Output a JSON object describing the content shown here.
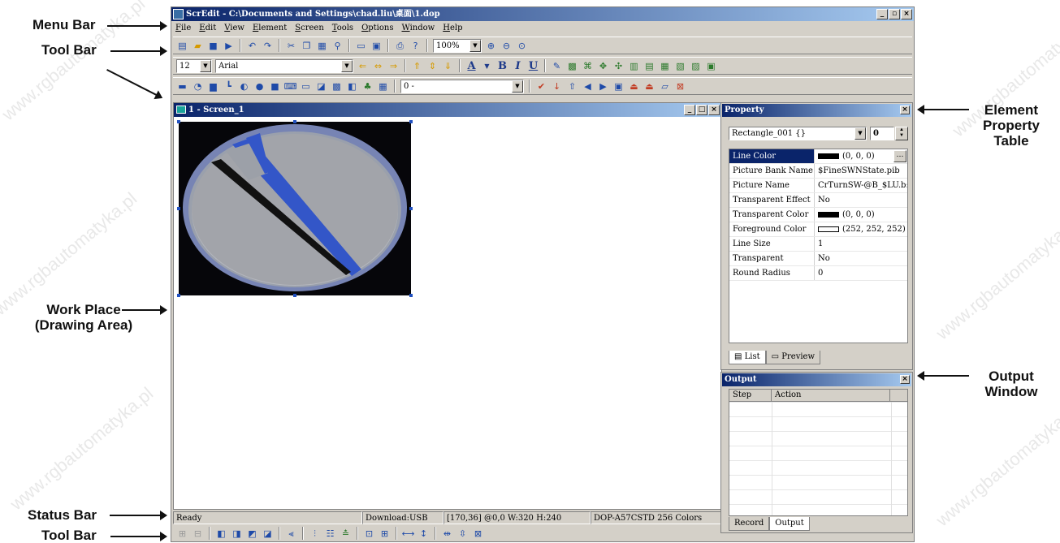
{
  "callouts": {
    "menu_bar": "Menu Bar",
    "tool_bar_top": "Tool Bar",
    "work_place_line1": "Work Place",
    "work_place_line2": "(Drawing Area)",
    "status_bar": "Status Bar",
    "tool_bar_bottom": "Tool Bar",
    "element_property_line1": "Element",
    "element_property_line2": "Property",
    "element_property_line3": "Table",
    "output_line1": "Output",
    "output_line2": "Window"
  },
  "window": {
    "title": "ScrEdit - C:\\Documents and Settings\\chad.liu\\桌面\\1.dop",
    "min_label": "_",
    "max_label": "▫",
    "close_label": "×"
  },
  "menu": [
    "File",
    "Edit",
    "View",
    "Element",
    "Screen",
    "Tools",
    "Options",
    "Window",
    "Help"
  ],
  "toolbar1": {
    "zoom_value": "100%"
  },
  "toolbar2": {
    "font_size": "12",
    "font_name": "Arial",
    "bold_label": "B",
    "italic_label": "I",
    "underline_label": "U",
    "font_color_label": "A"
  },
  "toolbar3": {
    "state_value": "0 -"
  },
  "mdi": {
    "title": "1 - Screen_1",
    "min_label": "_",
    "max_label": "□",
    "close_label": "×"
  },
  "property": {
    "title": "Property",
    "close_label": "×",
    "element_select": "Rectangle_001 {}",
    "state_value": "0",
    "rows": [
      {
        "name": "Line Color",
        "value": "(0, 0, 0)",
        "swatch": "#000000"
      },
      {
        "name": "Picture Bank Name",
        "value": "$FineSWNState.pib",
        "swatch": ""
      },
      {
        "name": "Picture Name",
        "value": "CrTurnSW-@B_$LU.b:",
        "swatch": ""
      },
      {
        "name": "Transparent Effect",
        "value": "No",
        "swatch": ""
      },
      {
        "name": "Transparent Color",
        "value": "(0, 0, 0)",
        "swatch": "#000000"
      },
      {
        "name": "Foreground Color",
        "value": "(252, 252, 252)",
        "swatch": "#fcfcfc"
      },
      {
        "name": "Line Size",
        "value": "1",
        "swatch": ""
      },
      {
        "name": "Transparent",
        "value": "No",
        "swatch": ""
      },
      {
        "name": "Round Radius",
        "value": "0",
        "swatch": ""
      }
    ],
    "tab_list": "List",
    "tab_preview": "Preview"
  },
  "output": {
    "title": "Output",
    "close_label": "×",
    "col_step": "Step",
    "col_action": "Action",
    "tab_record": "Record",
    "tab_output": "Output"
  },
  "status": {
    "ready": "Ready",
    "download": "Download:USB",
    "coords": "[170,36] @0,0 W:320 H:240",
    "model": "DOP-A57CSTD 256 Colors"
  },
  "watermark": "www.rgbautomatyka.pl"
}
